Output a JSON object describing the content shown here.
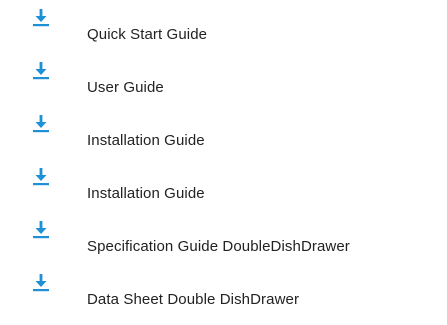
{
  "downloads": {
    "icon": "download-icon",
    "icon_color": "#1e90d6",
    "text_color": "#222222",
    "items": [
      {
        "label": "Quick Start Guide"
      },
      {
        "label": "User Guide"
      },
      {
        "label": "Installation Guide"
      },
      {
        "label": "Installation Guide"
      },
      {
        "label": "Specification Guide DoubleDishDrawer"
      },
      {
        "label": "Data Sheet Double DishDrawer"
      }
    ]
  }
}
